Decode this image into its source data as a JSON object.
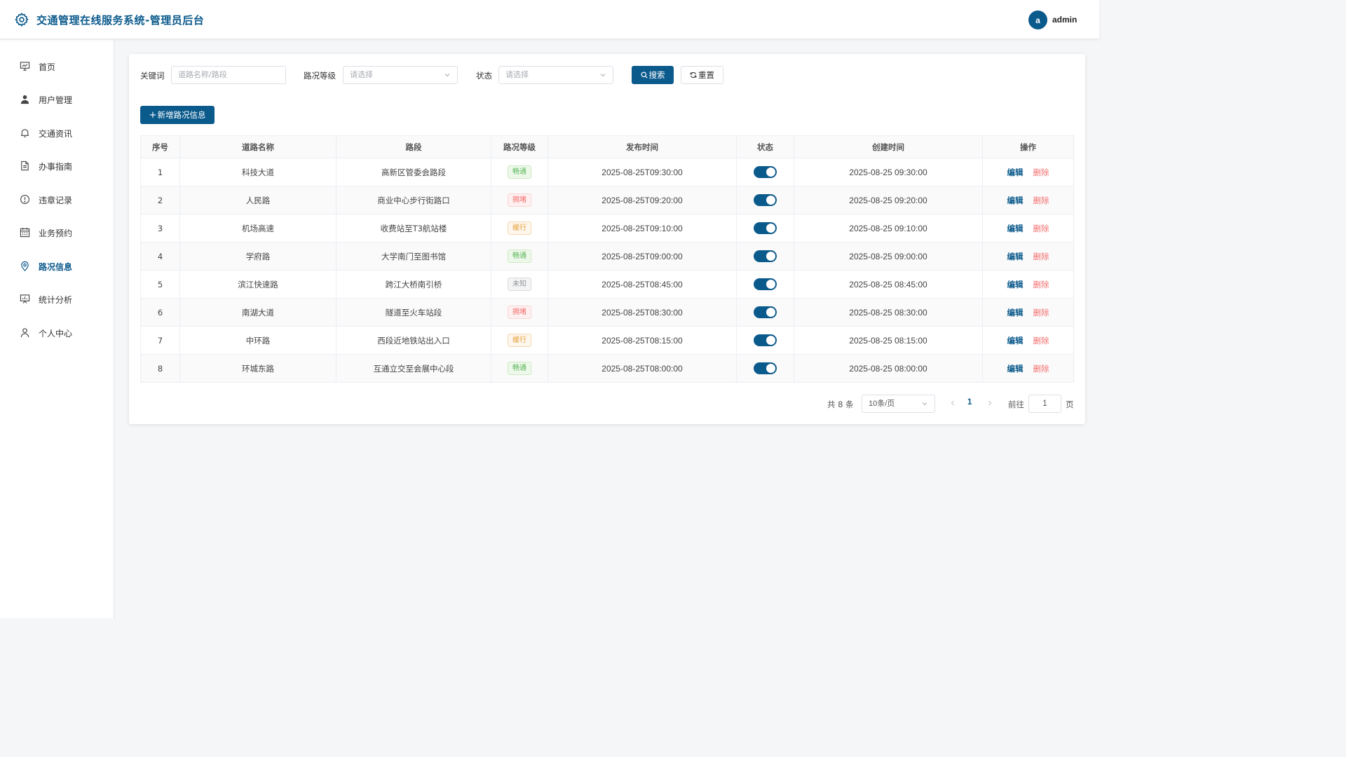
{
  "header": {
    "title": "交通管理在线服务系统-管理员后台",
    "avatar_letter": "a",
    "username": "admin"
  },
  "sidebar": {
    "items": [
      {
        "label": "首页",
        "icon": "chart-board-icon"
      },
      {
        "label": "用户管理",
        "icon": "user-icon"
      },
      {
        "label": "交通资讯",
        "icon": "bell-icon"
      },
      {
        "label": "办事指南",
        "icon": "document-icon"
      },
      {
        "label": "违章记录",
        "icon": "warning-icon"
      },
      {
        "label": "业务预约",
        "icon": "calendar-icon"
      },
      {
        "label": "路况信息",
        "icon": "location-icon",
        "active": true
      },
      {
        "label": "统计分析",
        "icon": "presentation-icon"
      },
      {
        "label": "个人中心",
        "icon": "user-outline-icon"
      }
    ]
  },
  "filters": {
    "keyword_label": "关键词",
    "keyword_placeholder": "道路名称/路段",
    "level_label": "路况等级",
    "level_placeholder": "请选择",
    "status_label": "状态",
    "status_placeholder": "请选择",
    "search_label": "搜索",
    "reset_label": "重置"
  },
  "add_button_label": "新增路况信息",
  "table": {
    "columns": [
      "序号",
      "道路名称",
      "路段",
      "路况等级",
      "发布时间",
      "状态",
      "创建时间",
      "操作"
    ],
    "edit_label": "编辑",
    "delete_label": "删除",
    "rows": [
      {
        "no": "1",
        "road": "科技大道",
        "section": "高新区管委会路段",
        "level": "畅通",
        "level_color": "green",
        "publish": "2025-08-25T09:30:00",
        "status": true,
        "created": "2025-08-25 09:30:00"
      },
      {
        "no": "2",
        "road": "人民路",
        "section": "商业中心步行街路口",
        "level": "拥堵",
        "level_color": "red",
        "publish": "2025-08-25T09:20:00",
        "status": true,
        "created": "2025-08-25 09:20:00"
      },
      {
        "no": "3",
        "road": "机场高速",
        "section": "收费站至T3航站楼",
        "level": "缓行",
        "level_color": "orange",
        "publish": "2025-08-25T09:10:00",
        "status": true,
        "created": "2025-08-25 09:10:00"
      },
      {
        "no": "4",
        "road": "学府路",
        "section": "大学南门至图书馆",
        "level": "畅通",
        "level_color": "green",
        "publish": "2025-08-25T09:00:00",
        "status": true,
        "created": "2025-08-25 09:00:00"
      },
      {
        "no": "5",
        "road": "滨江快速路",
        "section": "跨江大桥南引桥",
        "level": "未知",
        "level_color": "gray",
        "publish": "2025-08-25T08:45:00",
        "status": true,
        "created": "2025-08-25 08:45:00"
      },
      {
        "no": "6",
        "road": "南湖大道",
        "section": "隧道至火车站段",
        "level": "拥堵",
        "level_color": "red",
        "publish": "2025-08-25T08:30:00",
        "status": true,
        "created": "2025-08-25 08:30:00"
      },
      {
        "no": "7",
        "road": "中环路",
        "section": "西段近地铁站出入口",
        "level": "缓行",
        "level_color": "orange",
        "publish": "2025-08-25T08:15:00",
        "status": true,
        "created": "2025-08-25 08:15:00"
      },
      {
        "no": "8",
        "road": "环城东路",
        "section": "互通立交至会展中心段",
        "level": "畅通",
        "level_color": "green",
        "publish": "2025-08-25T08:00:00",
        "status": true,
        "created": "2025-08-25 08:00:00"
      }
    ]
  },
  "pagination": {
    "total_text": "共 8 条",
    "page_size": "10条/页",
    "current_page": "1",
    "goto_label": "前往",
    "goto_value": "1",
    "page_suffix": "页"
  },
  "colors": {
    "primary": "#0b5a8c",
    "danger": "#f56c6c",
    "success": "#5cb85c",
    "warning": "#e6a23c"
  }
}
